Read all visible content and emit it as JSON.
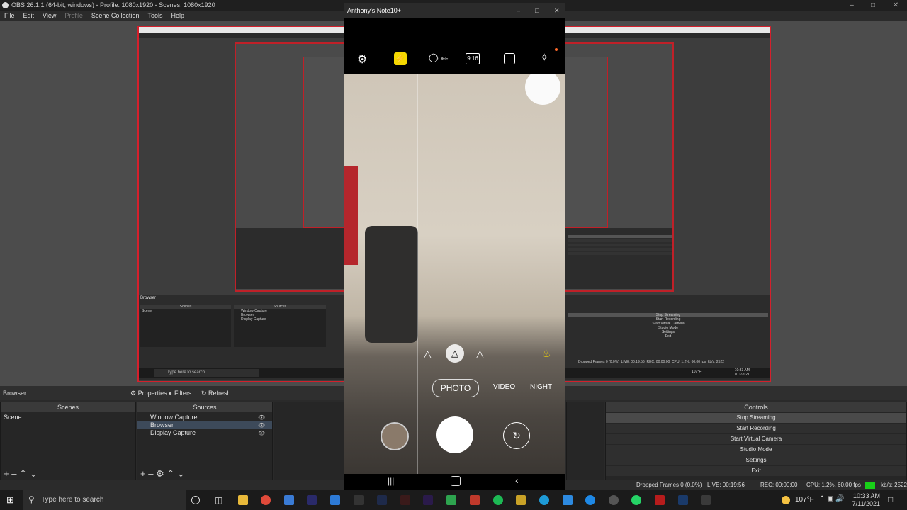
{
  "obs": {
    "title": "OBS 26.1.1 (64-bit, windows) - Profile: 1080x1920 - Scenes: 1080x1920",
    "menu": [
      "File",
      "Edit",
      "View",
      "Profile",
      "Scene Collection",
      "Tools",
      "Help"
    ],
    "source_toolbar": {
      "selected": "Browser",
      "properties": "Properties",
      "filters": "Filters",
      "refresh": "Refresh"
    },
    "scenes": {
      "header": "Scenes",
      "items": [
        "Scene"
      ]
    },
    "sources": {
      "header": "Sources",
      "items": [
        "Window Capture",
        "Browser",
        "Display Capture"
      ]
    },
    "controls": {
      "header": "Controls",
      "buttons": [
        "Stop Streaming",
        "Start Recording",
        "Start Virtual Camera",
        "Studio Mode",
        "Settings",
        "Exit"
      ]
    },
    "status": {
      "dropped": "Dropped Frames 0 (0.0%)",
      "live": "LIVE: 00:19:56",
      "rec": "REC: 00:00:00",
      "cpu": "CPU: 1.2%, 60.00 fps",
      "kbps": "kb/s: 2522"
    }
  },
  "phone": {
    "window_title": "Anthony's Note10+",
    "modes": [
      "PHOTO",
      "VIDEO",
      "NIGHT"
    ],
    "active_mode": "PHOTO",
    "top_icons": [
      "settings-icon",
      "flash-icon",
      "timer-off-icon",
      "ratio-9-16-icon",
      "motion-photo-icon",
      "effects-icon"
    ],
    "ratio_label": "9:16",
    "timer_label": "OFF"
  },
  "nested": {
    "search_placeholder": "Type here to search",
    "temp": "107°F",
    "time": "10:33 AM",
    "date": "7/11/2021",
    "live": "LIVE: 00:19:56",
    "rec": "REC: 00:00:00",
    "dropped": "Dropped Frames 0 (0.0%)",
    "cpu": "CPU: 1.2%, 60.00 fps",
    "kbps": "kb/s: 2522"
  },
  "taskbar": {
    "search_placeholder": "Type here to search",
    "temp": "107°F",
    "time": "10:33 AM",
    "date": "7/11/2021"
  }
}
